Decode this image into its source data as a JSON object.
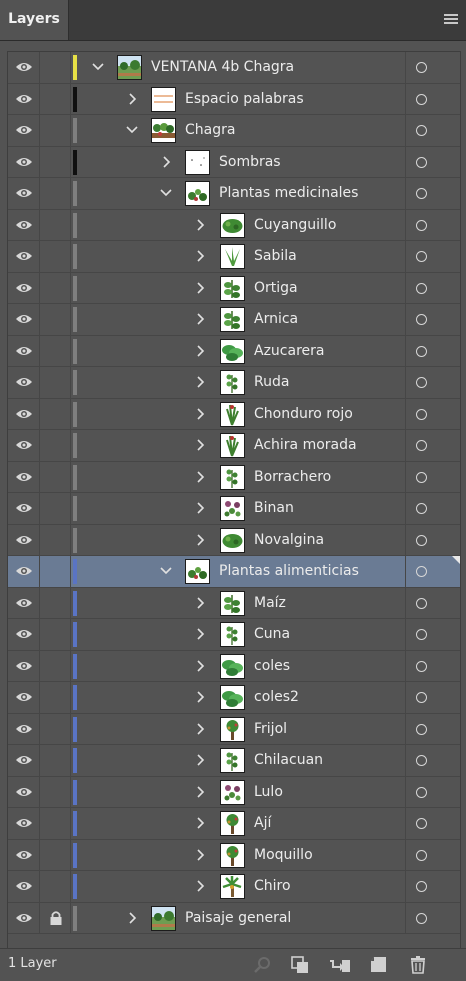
{
  "panel": {
    "tab_label": "Layers",
    "layer_count": "1 Layer"
  },
  "colors": {
    "yellow": "#e6e046",
    "black": "#101010",
    "gray": "#7f7f7f",
    "blue": "#5a74c4"
  },
  "rows": [
    {
      "name": "VENTANA 4b Chagra",
      "level": 0,
      "expanded": true,
      "color": "yellow",
      "thumb": "landscape"
    },
    {
      "name": "Espacio palabras",
      "level": 1,
      "expanded": false,
      "color": "black",
      "thumb": "lines"
    },
    {
      "name": "Chagra",
      "level": 1,
      "expanded": true,
      "color": "gray",
      "thumb": "garden"
    },
    {
      "name": "Sombras",
      "level": 2,
      "expanded": false,
      "color": "black",
      "thumb": "dots"
    },
    {
      "name": "Plantas medicinales",
      "level": 2,
      "expanded": true,
      "color": "gray",
      "thumb": "herbs"
    },
    {
      "name": "Cuyanguillo",
      "level": 3,
      "expanded": false,
      "color": "gray",
      "thumb": "bush"
    },
    {
      "name": "Sabila",
      "level": 3,
      "expanded": false,
      "color": "gray",
      "thumb": "aloe"
    },
    {
      "name": "Ortiga",
      "level": 3,
      "expanded": false,
      "color": "gray",
      "thumb": "leafy"
    },
    {
      "name": "Arnica",
      "level": 3,
      "expanded": false,
      "color": "gray",
      "thumb": "leafy"
    },
    {
      "name": "Azucarera",
      "level": 3,
      "expanded": false,
      "color": "gray",
      "thumb": "broad"
    },
    {
      "name": "Ruda",
      "level": 3,
      "expanded": false,
      "color": "gray",
      "thumb": "sprig"
    },
    {
      "name": "Chonduro rojo",
      "level": 3,
      "expanded": false,
      "color": "gray",
      "thumb": "tall"
    },
    {
      "name": "Achira morada",
      "level": 3,
      "expanded": false,
      "color": "gray",
      "thumb": "tall"
    },
    {
      "name": "Borrachero",
      "level": 3,
      "expanded": false,
      "color": "gray",
      "thumb": "sprig"
    },
    {
      "name": "Binan",
      "level": 3,
      "expanded": false,
      "color": "gray",
      "thumb": "flower"
    },
    {
      "name": "Novalgina",
      "level": 3,
      "expanded": false,
      "color": "gray",
      "thumb": "bush"
    },
    {
      "name": "Plantas alimenticias",
      "level": 2,
      "expanded": true,
      "color": "blue",
      "thumb": "herbs",
      "selected": true
    },
    {
      "name": "Maíz",
      "level": 3,
      "expanded": false,
      "color": "blue",
      "thumb": "leafy"
    },
    {
      "name": "Cuna",
      "level": 3,
      "expanded": false,
      "color": "blue",
      "thumb": "sprig"
    },
    {
      "name": "coles",
      "level": 3,
      "expanded": false,
      "color": "blue",
      "thumb": "broad"
    },
    {
      "name": "coles2",
      "level": 3,
      "expanded": false,
      "color": "blue",
      "thumb": "broad"
    },
    {
      "name": "Frijol",
      "level": 3,
      "expanded": false,
      "color": "blue",
      "thumb": "tree"
    },
    {
      "name": "Chilacuan",
      "level": 3,
      "expanded": false,
      "color": "blue",
      "thumb": "sprig"
    },
    {
      "name": "Lulo",
      "level": 3,
      "expanded": false,
      "color": "blue",
      "thumb": "flower"
    },
    {
      "name": "Ají",
      "level": 3,
      "expanded": false,
      "color": "blue",
      "thumb": "tree"
    },
    {
      "name": "Moquillo",
      "level": 3,
      "expanded": false,
      "color": "blue",
      "thumb": "tree"
    },
    {
      "name": "Chiro",
      "level": 3,
      "expanded": false,
      "color": "blue",
      "thumb": "palm"
    },
    {
      "name": "Paisaje general",
      "level": 1,
      "expanded": false,
      "color": "gray",
      "thumb": "landscape",
      "locked": true
    }
  ],
  "footer_buttons": [
    {
      "name": "search-icon",
      "label": "Locate Object"
    },
    {
      "name": "clipping-mask-icon",
      "label": "Make/Release Clipping Mask"
    },
    {
      "name": "new-sublayer-icon",
      "label": "Create New Sublayer"
    },
    {
      "name": "new-layer-icon",
      "label": "Create New Layer"
    },
    {
      "name": "trash-icon",
      "label": "Delete Selection"
    }
  ]
}
